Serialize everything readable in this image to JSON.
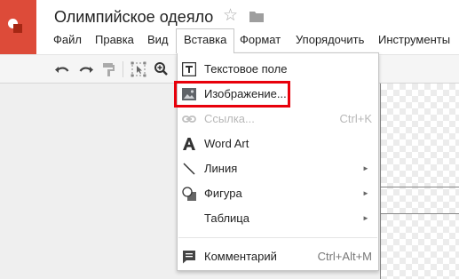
{
  "app": {
    "title": "Олимпийское одеяло",
    "logo": "google-drawings-logo",
    "brand_color": "#dd4b39"
  },
  "menubar": {
    "items": [
      {
        "label": "Файл"
      },
      {
        "label": "Правка"
      },
      {
        "label": "Вид"
      },
      {
        "label": "Вставка"
      },
      {
        "label": "Формат"
      },
      {
        "label": "Упорядочить"
      },
      {
        "label": "Инструменты"
      }
    ],
    "active": "Вставка"
  },
  "toolbar": {
    "buttons": [
      "undo-icon",
      "redo-icon",
      "paint-format-icon",
      "select-icon",
      "zoom-icon"
    ]
  },
  "insert_menu": {
    "items": [
      {
        "label": "Текстовое поле",
        "icon": "text-box-icon",
        "shortcut": "",
        "submenu": false,
        "disabled": false
      },
      {
        "label": "Изображение...",
        "icon": "image-icon",
        "shortcut": "",
        "submenu": false,
        "disabled": false,
        "highlighted": true
      },
      {
        "label": "Ссылка...",
        "icon": "link-icon",
        "shortcut": "Ctrl+K",
        "submenu": false,
        "disabled": true
      },
      {
        "label": "Word Art",
        "icon": "word-art-icon",
        "shortcut": "",
        "submenu": false,
        "disabled": false
      },
      {
        "label": "Линия",
        "icon": "line-icon",
        "shortcut": "",
        "submenu": true,
        "disabled": false
      },
      {
        "label": "Фигура",
        "icon": "shape-icon",
        "shortcut": "",
        "submenu": true,
        "disabled": false
      },
      {
        "label": "Таблица",
        "icon": "",
        "shortcut": "",
        "submenu": true,
        "disabled": false
      },
      {
        "label": "Комментарий",
        "icon": "comment-icon",
        "shortcut": "Ctrl+Alt+M",
        "submenu": false,
        "disabled": false
      }
    ],
    "submenu_arrow": "►"
  },
  "colors": {
    "highlight": "#e8000b",
    "disabled_text": "#b8b8b8"
  }
}
